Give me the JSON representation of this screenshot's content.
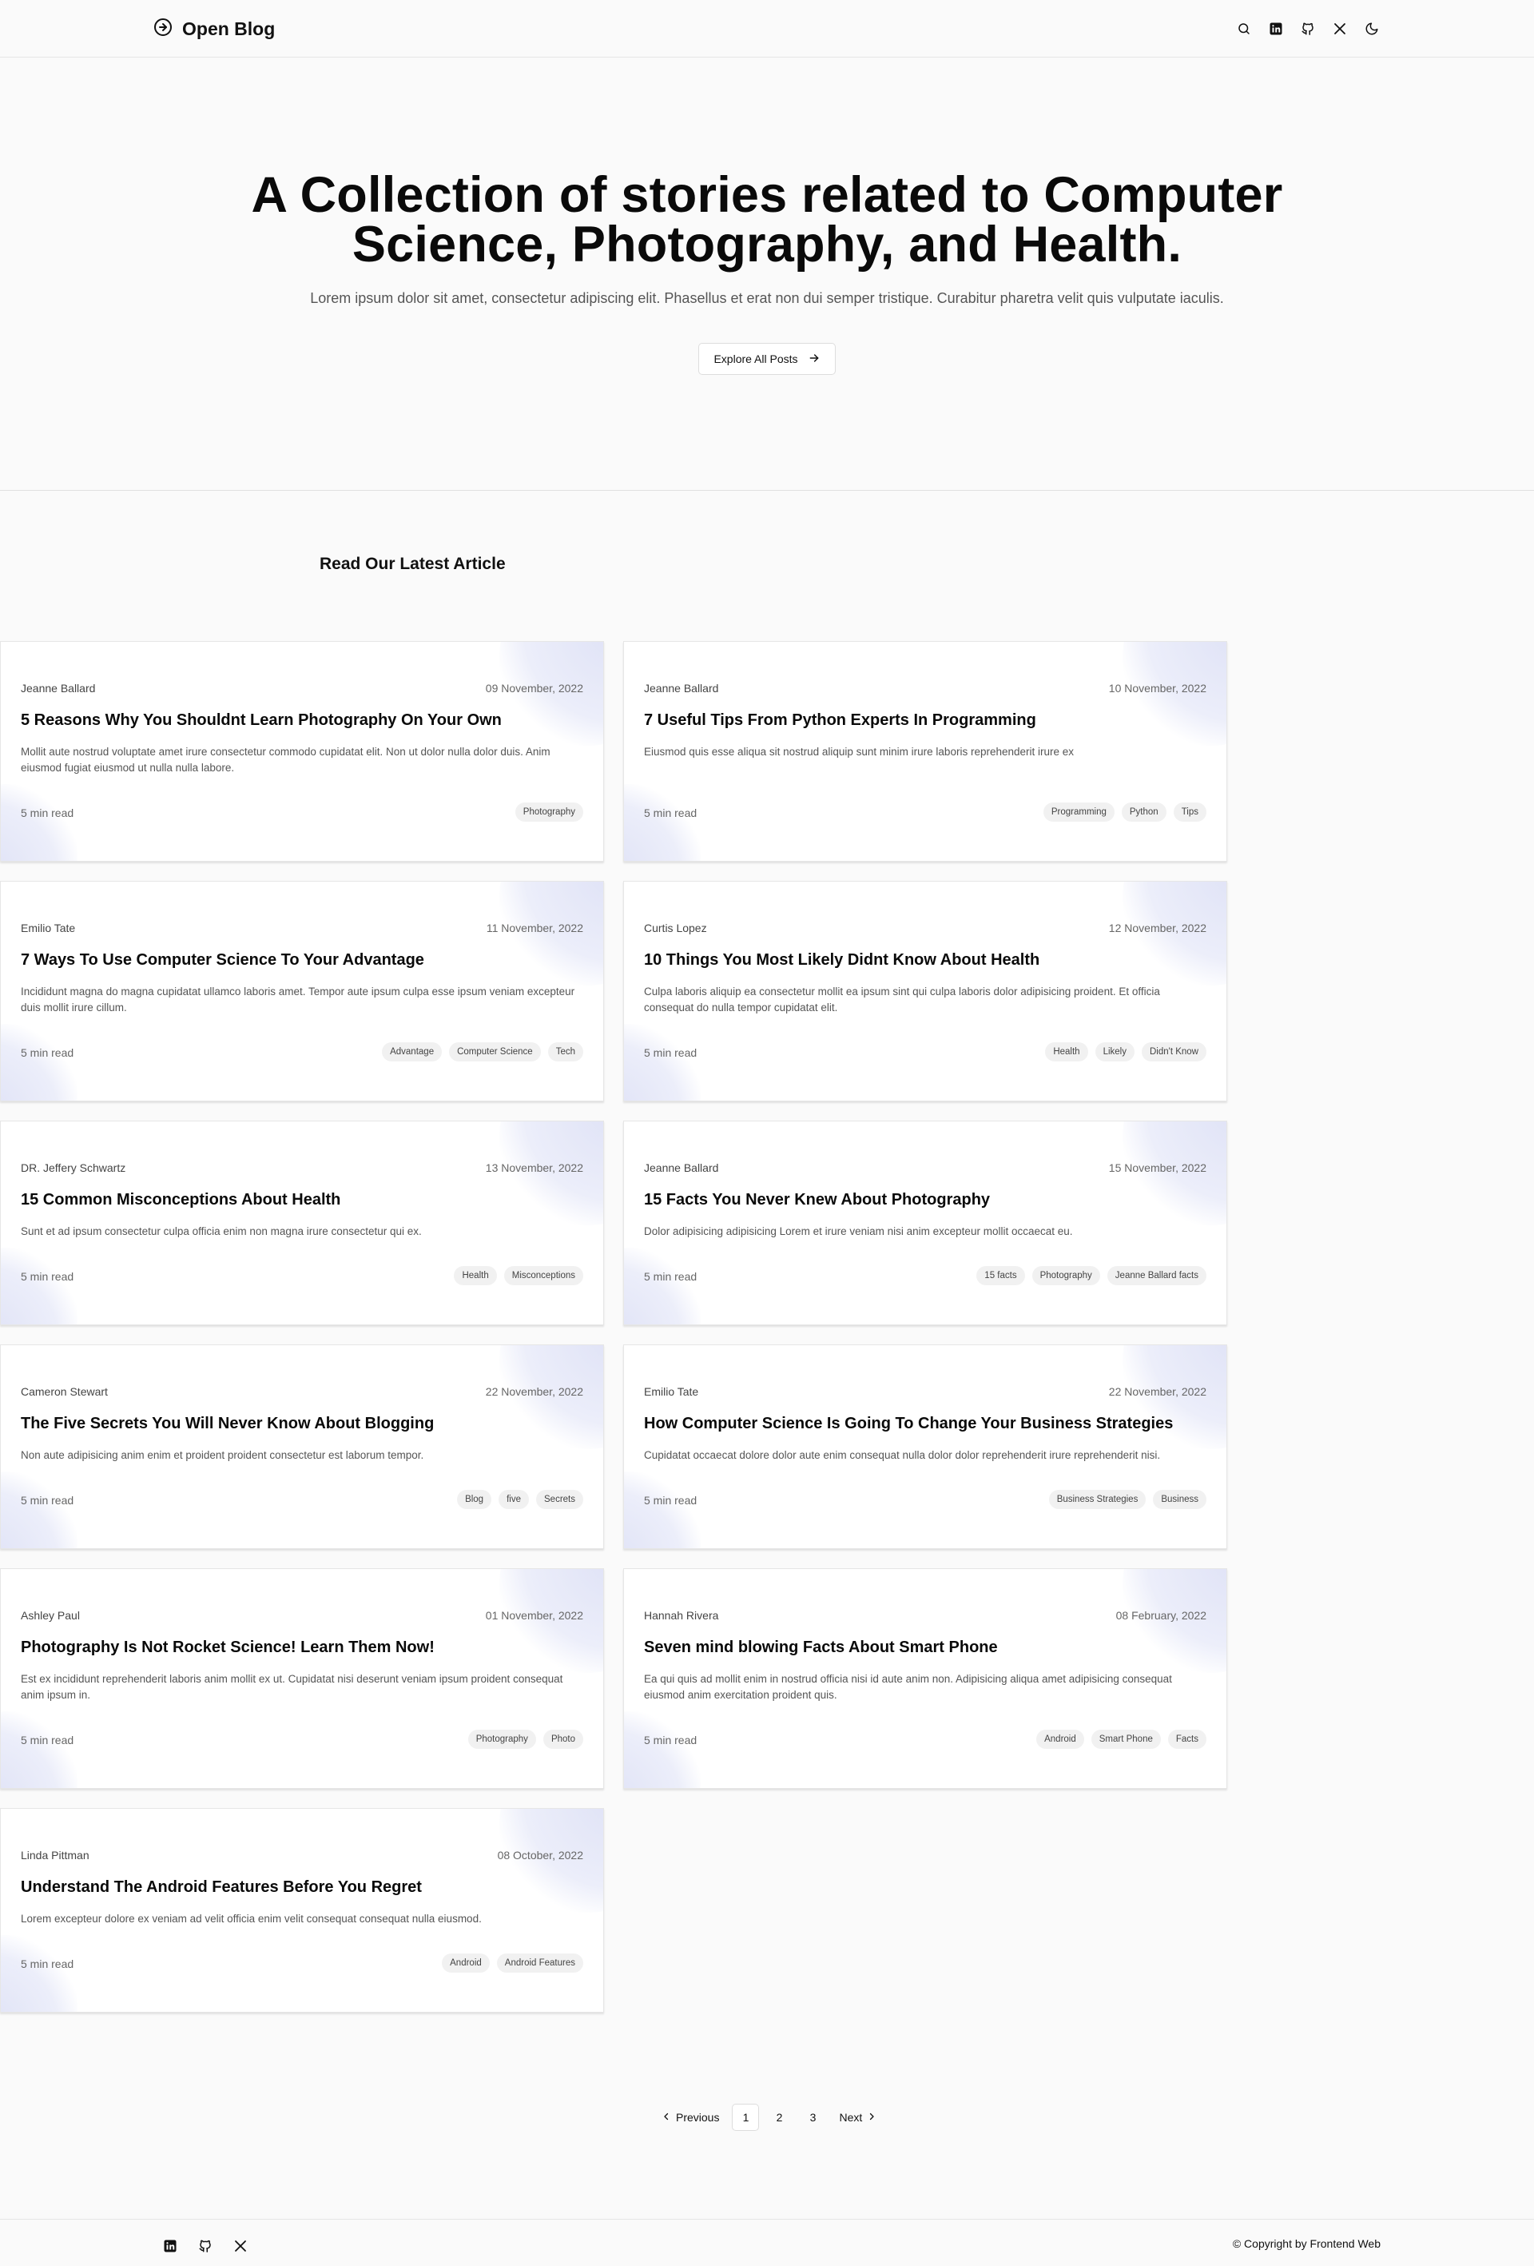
{
  "header": {
    "brand": "Open Blog"
  },
  "hero": {
    "title": "A Collection of stories related to Computer Science, Photography, and Health.",
    "subtitle": "Lorem ipsum dolor sit amet, consectetur adipiscing elit. Phasellus et erat non dui semper tristique. Curabitur pharetra velit quis vulputate iaculis.",
    "cta": "Explore All Posts"
  },
  "section": {
    "title": "Read Our Latest Article"
  },
  "articles": [
    {
      "author": "Jeanne Ballard",
      "date": "09 November, 2022",
      "title": "5 Reasons Why You Shouldnt Learn Photography On Your Own",
      "desc": "Mollit aute nostrud voluptate amet irure consectetur commodo cupidatat elit. Non ut dolor nulla dolor duis. Anim eiusmod fugiat eiusmod ut nulla nulla labore.",
      "read": "5 min read",
      "tags": [
        "Photography"
      ]
    },
    {
      "author": "Jeanne Ballard",
      "date": "10 November, 2022",
      "title": "7 Useful Tips From Python Experts In Programming",
      "desc": "Eiusmod quis esse aliqua sit nostrud aliquip sunt minim irure laboris reprehenderit irure ex",
      "read": "5 min read",
      "tags": [
        "Programming",
        "Python",
        "Tips"
      ]
    },
    {
      "author": "Emilio Tate",
      "date": "11 November, 2022",
      "title": "7 Ways To Use Computer Science To Your Advantage",
      "desc": "Incididunt magna do magna cupidatat ullamco laboris amet. Tempor aute ipsum culpa esse ipsum veniam excepteur duis mollit irure cillum.",
      "read": "5 min read",
      "tags": [
        "Advantage",
        "Computer Science",
        "Tech"
      ]
    },
    {
      "author": "Curtis Lopez",
      "date": "12 November, 2022",
      "title": "10 Things You Most Likely Didnt Know About Health",
      "desc": "Culpa laboris aliquip ea consectetur mollit ea ipsum sint qui culpa laboris dolor adipisicing proident. Et officia consequat do nulla tempor cupidatat elit.",
      "read": "5 min read",
      "tags": [
        "Health",
        "Likely",
        "Didn't Know"
      ]
    },
    {
      "author": "DR. Jeffery Schwartz",
      "date": "13 November, 2022",
      "title": "15 Common Misconceptions About Health",
      "desc": "Sunt et ad ipsum consectetur culpa officia enim non magna irure consectetur qui ex.",
      "read": "5 min read",
      "tags": [
        "Health",
        "Misconceptions"
      ]
    },
    {
      "author": "Jeanne Ballard",
      "date": "15 November, 2022",
      "title": "15 Facts You Never Knew About Photography",
      "desc": "Dolor adipisicing adipisicing Lorem et irure veniam nisi anim excepteur mollit occaecat eu.",
      "read": "5 min read",
      "tags": [
        "15 facts",
        "Photography",
        "Jeanne Ballard facts"
      ]
    },
    {
      "author": "Cameron Stewart",
      "date": "22 November, 2022",
      "title": "The Five Secrets You Will Never Know About Blogging",
      "desc": "Non aute adipisicing anim enim et proident proident consectetur est laborum tempor.",
      "read": "5 min read",
      "tags": [
        "Blog",
        "five",
        "Secrets"
      ]
    },
    {
      "author": "Emilio Tate",
      "date": "22 November, 2022",
      "title": "How Computer Science Is Going To Change Your Business Strategies",
      "desc": "Cupidatat occaecat dolore dolor aute enim consequat nulla dolor dolor reprehenderit irure reprehenderit nisi.",
      "read": "5 min read",
      "tags": [
        "Business Strategies",
        "Business"
      ]
    },
    {
      "author": "Ashley Paul",
      "date": "01 November, 2022",
      "title": "Photography Is Not Rocket Science! Learn Them Now!",
      "desc": "Est ex incididunt reprehenderit laboris anim mollit ex ut. Cupidatat nisi deserunt veniam ipsum proident consequat anim ipsum in.",
      "read": "5 min read",
      "tags": [
        "Photography",
        "Photo"
      ]
    },
    {
      "author": "Hannah Rivera",
      "date": "08 February, 2022",
      "title": "Seven mind blowing Facts About Smart Phone",
      "desc": "Ea qui quis ad mollit enim in nostrud officia nisi id aute anim non. Adipisicing aliqua amet adipisicing consequat eiusmod anim exercitation proident quis.",
      "read": "5 min read",
      "tags": [
        "Android",
        "Smart Phone",
        "Facts"
      ]
    },
    {
      "author": "Linda Pittman",
      "date": "08 October, 2022",
      "title": "Understand The Android Features Before You Regret",
      "desc": "Lorem excepteur dolore ex veniam ad velit officia enim velit consequat consequat nulla eiusmod.",
      "read": "5 min read",
      "tags": [
        "Android",
        "Android Features"
      ]
    }
  ],
  "pagination": {
    "previous": "Previous",
    "pages": [
      "1",
      "2",
      "3"
    ],
    "active": "1",
    "next": "Next"
  },
  "footer": {
    "copyright": "© Copyright by Frontend Web"
  },
  "icons": {
    "brand": "circle-arrow-icon",
    "header": [
      "search-icon",
      "linkedin-icon",
      "github-icon",
      "x-icon",
      "moon-icon"
    ],
    "footer": [
      "linkedin-icon",
      "github-icon",
      "x-icon"
    ]
  }
}
